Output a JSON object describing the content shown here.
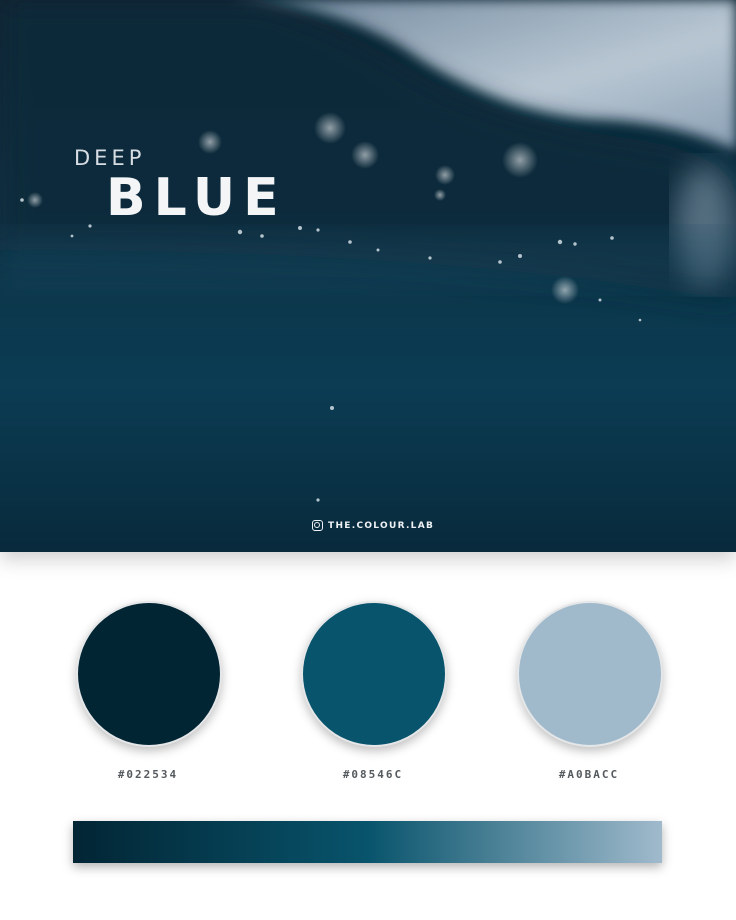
{
  "hero": {
    "title_small": "DEEP",
    "title_large": "BLUE",
    "credit": "THE.COLOUR.LAB",
    "credit_icon": "instagram-icon"
  },
  "palette": [
    {
      "hex": "#022534",
      "label": "#022534"
    },
    {
      "hex": "#08546C",
      "label": "#08546C"
    },
    {
      "hex": "#A0BACC",
      "label": "#A0BACC"
    }
  ],
  "gradient": {
    "colors": [
      "#022534",
      "#08546C",
      "#A0BACC"
    ]
  }
}
